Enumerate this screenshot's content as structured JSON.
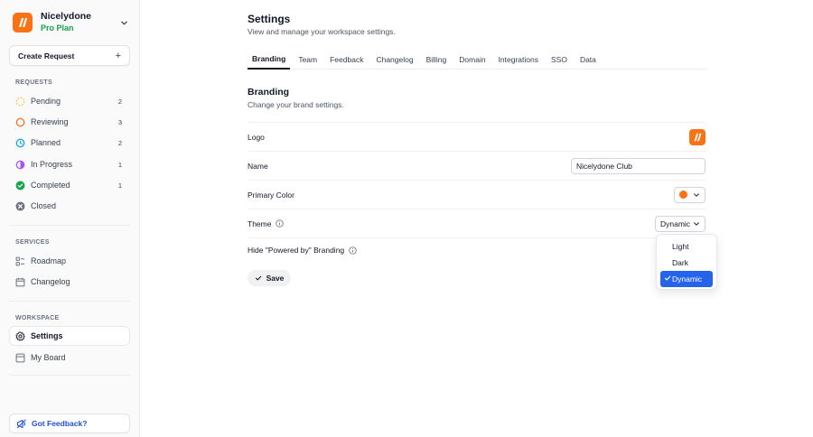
{
  "workspace": {
    "name": "Nicelydone",
    "plan": "Pro Plan"
  },
  "sidebar": {
    "create_label": "Create Request",
    "requests_label": "REQUESTS",
    "requests": [
      {
        "label": "Pending",
        "count": "2"
      },
      {
        "label": "Reviewing",
        "count": "3"
      },
      {
        "label": "Planned",
        "count": "2"
      },
      {
        "label": "In Progress",
        "count": "1"
      },
      {
        "label": "Completed",
        "count": "1"
      },
      {
        "label": "Closed",
        "count": ""
      }
    ],
    "services_label": "SERVICES",
    "services": [
      {
        "label": "Roadmap"
      },
      {
        "label": "Changelog"
      }
    ],
    "workspace_label": "WORKSPACE",
    "workspace_items": [
      {
        "label": "Settings",
        "active": true
      },
      {
        "label": "My Board"
      }
    ],
    "feedback_label": "Got Feedback?"
  },
  "header": {
    "title": "Settings",
    "subtitle": "View and manage your workspace settings."
  },
  "tabs": [
    "Branding",
    "Team",
    "Feedback",
    "Changelog",
    "Billing",
    "Domain",
    "Integrations",
    "SSO",
    "Data"
  ],
  "active_tab": "Branding",
  "branding": {
    "title": "Branding",
    "description": "Change your brand settings.",
    "logo_label": "Logo",
    "name_label": "Name",
    "name_value": "Nicelydone Club",
    "primary_color_label": "Primary Color",
    "primary_color": "#f97316",
    "theme_label": "Theme",
    "theme_value": "Dynamic",
    "hide_branding_label": "Hide \"Powered by\" Branding",
    "save_label": "Save"
  },
  "theme_options": [
    {
      "label": "Light",
      "selected": false
    },
    {
      "label": "Dark",
      "selected": false
    },
    {
      "label": "Dynamic",
      "selected": true
    }
  ],
  "colors": {
    "accent_orange": "#f97316",
    "plan_green": "#16a34a",
    "selected_blue": "#2563eb",
    "pending": "#f5c542",
    "reviewing": "#f97316",
    "planned": "#0ea5e9",
    "in_progress": "#a855f7",
    "completed": "#16a34a",
    "closed": "#6b7280"
  }
}
